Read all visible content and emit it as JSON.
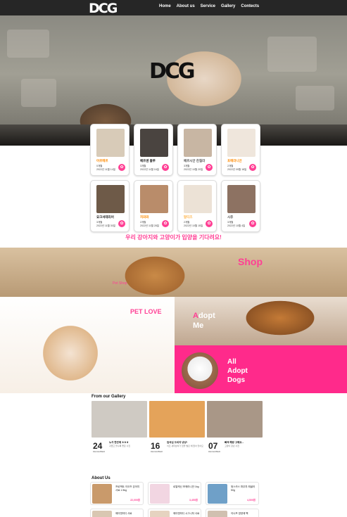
{
  "nav": {
    "logo": "DCG",
    "items": [
      "Home",
      "About us",
      "Service",
      "Gallery",
      "Contects"
    ]
  },
  "hero": {
    "logo": "DCG"
  },
  "pets": [
    {
      "name": "아르메르",
      "info1": "0개월",
      "info2": "2022년 11월 14일",
      "name_color": "#ff8a00",
      "img": "#d8cbb8"
    },
    {
      "name": "페르센 블루",
      "info1": "3개월",
      "info2": "2022년 11월 16일",
      "name_color": "#222222",
      "img": "#4a4440"
    },
    {
      "name": "페르시안 친칠라",
      "info1": "3개월",
      "info2": "2022년 10월 20일",
      "name_color": "#555555",
      "img": "#c8b6a3"
    },
    {
      "name": "포메라니안",
      "info1": "2개월",
      "info2": "2022년 09월 18일",
      "name_color": "#ff8a00",
      "img": "#efe6dc"
    },
    {
      "name": "요크셔테리어",
      "info1": "3개월",
      "info2": "2022년 11월 30일",
      "name_color": "#222222",
      "img": "#6e5a48"
    },
    {
      "name": "치와와",
      "info1": "2개월",
      "info2": "2022년 11월 28일",
      "name_color": "#ff8a00",
      "img": "#b98c6a"
    },
    {
      "name": "말티즈",
      "info1": "2개월",
      "info2": "2022년 10월 15일",
      "name_color": "#ffb347",
      "img": "#ece2d6"
    },
    {
      "name": "시츄",
      "info1": "3개월",
      "info2": "2022년 10월 4일",
      "name_color": "#555555",
      "img": "#8d7262"
    }
  ],
  "wait_message": "우리 강아지와 고양이가 입양을 기다려요!",
  "shop": {
    "title": "Shop",
    "tag": "Pet Shop"
  },
  "petlove": {
    "title": "PET LOVE"
  },
  "adopt": {
    "first": "A",
    "rest": "dopt",
    "line2": "Me"
  },
  "all_adopt": {
    "line1": "All",
    "line2": "Adopt",
    "line3": "Dogs"
  },
  "gallery": {
    "title": "From our Gallery",
    "items": [
      {
        "day": "24",
        "mon": "DECEMBER",
        "title": "누가 한잔에 ㅎㅎㅎ",
        "desc": "귀엽고 볼수록 좋은 사진",
        "img": "#cfcac3"
      },
      {
        "day": "16",
        "mon": "DECEMBER",
        "title": "입국심 오리지 냥냥!",
        "desc": "치즈 새끼냥이가 입을 벌린 채 앉아 있어요",
        "img": "#e4a35a"
      },
      {
        "day": "07",
        "mon": "DECEMBER",
        "title": "빠져 해랑 고예요...",
        "desc": "고양이 장난 사진",
        "img": "#a99787"
      }
    ]
  },
  "about": {
    "title": "About Us",
    "items": [
      {
        "name": "프로젝트 이오즈 강아지 사료 1.5kg",
        "price": "22,000원",
        "img": "#c99a6b"
      },
      {
        "name": "로얄캐닌 포메라니안 1kg",
        "price": "3,450원",
        "img": "#f2d6e2"
      },
      {
        "name": "위스카스 파우치 레귤러 50g",
        "price": "4,500원",
        "img": "#6fa0c8"
      },
      {
        "name": "에이엔미디 사료",
        "price": "",
        "img": "#d9c7b2"
      },
      {
        "name": "에이엔미디 시그니처 사료",
        "price": "",
        "img": "#e6d3c0"
      },
      {
        "name": "이너프 영양제 팩",
        "price": "",
        "img": "#d0c0b0"
      }
    ]
  }
}
